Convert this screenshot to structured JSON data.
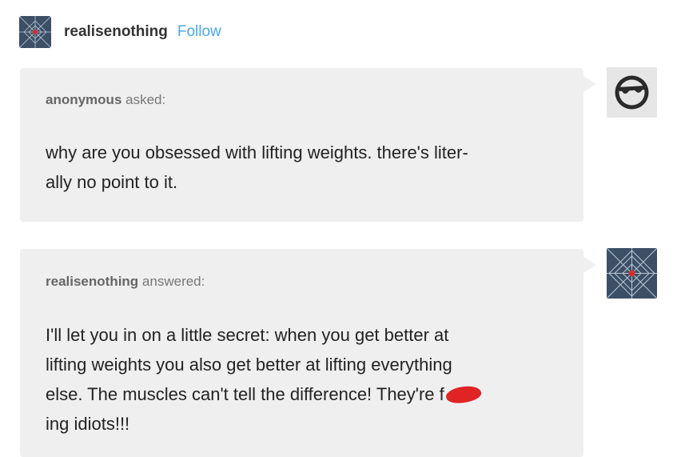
{
  "header": {
    "username": "realisenothing",
    "follow_label": "Follow"
  },
  "question": {
    "asker_name": "anonymous",
    "asker_verb": "asked:",
    "lines": [
      "why are you obsessed with lifting weights. there's liter-",
      "ally no point to it."
    ]
  },
  "answer": {
    "responder_name": "realisenothing",
    "responder_verb": "answered:",
    "lines": [
      "I'll let you in on a little secret: when you get better at",
      "lifting weights you also get better at lifting everything",
      "else. The muscles can't tell the difference! They're f",
      "ing idiots!!!"
    ]
  },
  "colors": {
    "accent": "#4aa8e8",
    "bubble": "#efefef",
    "censor": "#e02424",
    "avatar_bg": "#3b4f66"
  },
  "icons": {
    "anon_avatar": "sunglasses-face-icon",
    "user_avatar": "spiderweb-avatar-icon"
  }
}
